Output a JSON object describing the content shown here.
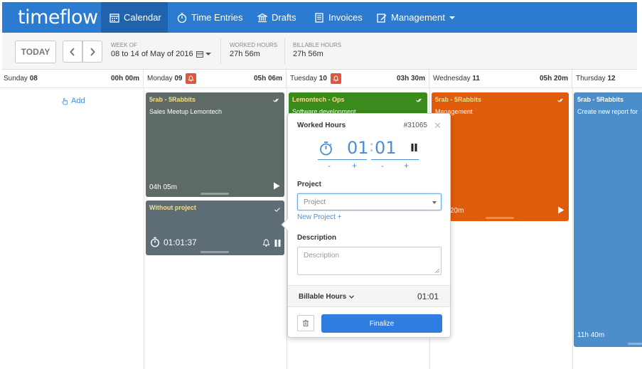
{
  "colors": {
    "nav_bg": "#2b7bd0",
    "nav_active": "#1f63ad",
    "accent": "#2f7de1",
    "bell": "#e0563b",
    "card_gray": "#5e6a67",
    "card_slate": "#5d6c75",
    "card_green": "#3a8a1c",
    "card_orange": "#e05c0d",
    "card_blue": "#4c8ec9"
  },
  "nav": {
    "logo": "timeflow",
    "items": [
      {
        "label": "Calendar",
        "icon": "calendar-icon"
      },
      {
        "label": "Time Entries",
        "icon": "stopwatch-icon"
      },
      {
        "label": "Drafts",
        "icon": "bank-icon"
      },
      {
        "label": "Invoices",
        "icon": "document-icon"
      },
      {
        "label": "Management",
        "icon": "edit-icon"
      }
    ]
  },
  "toolbar": {
    "today": "TODAY",
    "week_label": "WEEK OF",
    "week_value": "08 to 14 of May of 2016",
    "worked_label": "WORKED HOURS",
    "worked_value": "27h 56m",
    "billable_label": "BILLABLE HOURS",
    "billable_value": "27h 56m"
  },
  "days": [
    {
      "name": "Sunday",
      "num": "08",
      "hours": "00h 00m",
      "bell": false
    },
    {
      "name": "Monday",
      "num": "09",
      "hours": "05h 06m",
      "bell": true
    },
    {
      "name": "Tuesday",
      "num": "10",
      "hours": "03h 30m",
      "bell": true
    },
    {
      "name": "Wednesday",
      "num": "11",
      "hours": "05h 20m",
      "bell": false
    },
    {
      "name": "Thursday",
      "num": "12",
      "hours": "",
      "bell": false
    }
  ],
  "add_label": "Add",
  "cards": {
    "mon1": {
      "title": "5rab - 5Rabbits",
      "desc": "Sales Meetup Lemontech",
      "hours": "04h 05m"
    },
    "mon2": {
      "title": "Without project",
      "timer": "01:01:37"
    },
    "tue1": {
      "title": "Lemontech - Ops",
      "desc": "Software development"
    },
    "wed1": {
      "title": "5rab - 5Rabbits",
      "desc": "Management",
      "hours": "20m"
    },
    "thu1": {
      "title": "5rab - 5Rabbits",
      "desc": "Create new report for",
      "hours": "11h 40m"
    }
  },
  "popover": {
    "title": "Worked Hours",
    "id": "#31065",
    "hours": "01",
    "minutes": "01",
    "minus": "-",
    "plus": "+",
    "project_label": "Project",
    "project_placeholder": "Project",
    "new_project": "New Project +",
    "description_label": "Description",
    "description_placeholder": "Description",
    "billable_label": "Billable Hours",
    "billable_value": "01:01",
    "finalize": "Finalize"
  }
}
